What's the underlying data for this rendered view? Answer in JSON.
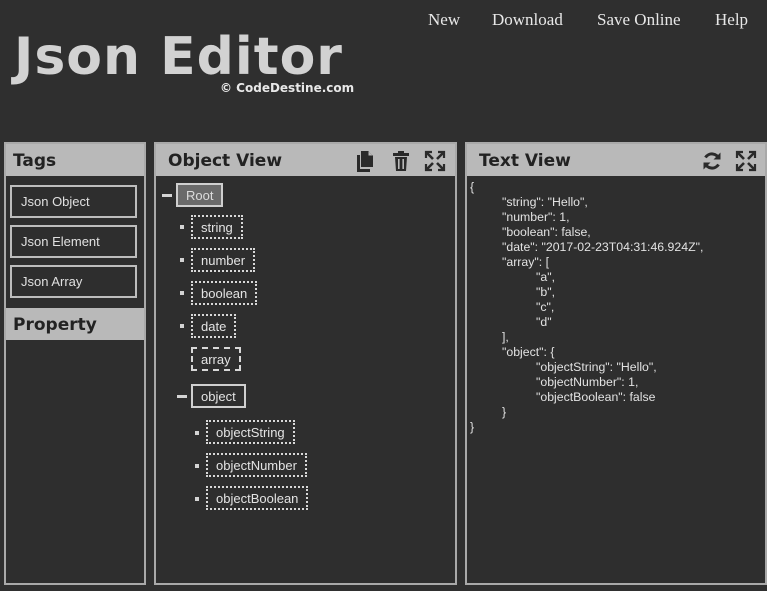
{
  "nav": {
    "new": "New",
    "download": "Download",
    "save_online": "Save Online",
    "help": "Help"
  },
  "brand": {
    "title": "Json Editor",
    "credit": "© CodeDestine.com"
  },
  "tags_panel": {
    "header": "Tags",
    "items": [
      {
        "label": "Json Object"
      },
      {
        "label": "Json Element"
      },
      {
        "label": "Json Array"
      }
    ],
    "property_header": "Property"
  },
  "object_view": {
    "header": "Object View",
    "icons": [
      "copy-icon",
      "trash-icon",
      "expand-icon"
    ],
    "nodes": {
      "root": "Root",
      "string": "string",
      "number": "number",
      "boolean": "boolean",
      "date": "date",
      "array": "array",
      "object": "object",
      "objectString": "objectString",
      "objectNumber": "objectNumber",
      "objectBoolean": "objectBoolean"
    }
  },
  "text_view": {
    "header": "Text View",
    "icons": [
      "refresh-icon",
      "expand-icon"
    ],
    "lines": [
      "{",
      "\"string\": \"Hello\",",
      "\"number\": 1,",
      "\"boolean\": false,",
      "\"date\": \"2017-02-23T04:31:46.924Z\",",
      "\"array\": [",
      "\"a\",",
      "\"b\",",
      "\"c\",",
      "\"d\"",
      "],",
      "\"object\": {",
      "\"objectString\": \"Hello\",",
      "\"objectNumber\": 1,",
      "\"objectBoolean\": false",
      "}",
      "}"
    ]
  },
  "colors": {
    "background": "#2f2f2f",
    "panel_header": "#b9b9b9",
    "panel_border": "#a9a9a9",
    "text": "#e6e6e6"
  }
}
